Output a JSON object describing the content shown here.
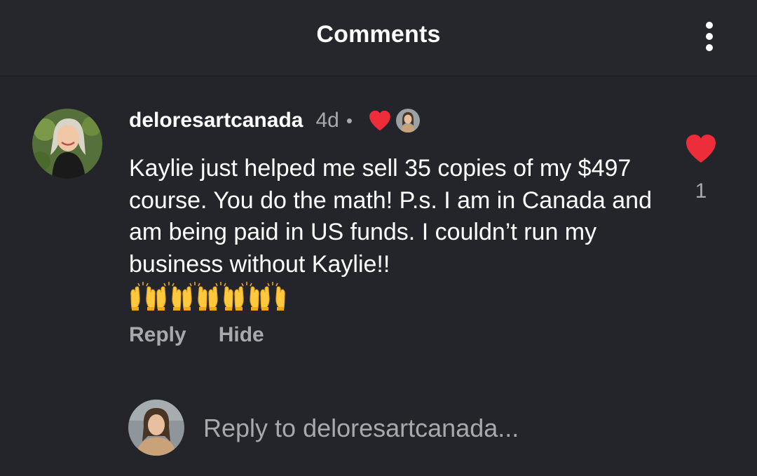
{
  "header": {
    "title": "Comments",
    "menu_icon": "more-vertical-icon"
  },
  "comment": {
    "username": "deloresartcanada",
    "time": "4d",
    "separator": "•",
    "liked_by_author": true,
    "text": "Kaylie just helped me sell 35 copies of my $497 course. You do the math!  P.s. I am in Canada and am being paid in US funds. I couldn’t run my business without Kaylie!!",
    "emoji": "raising-hands-icon",
    "emoji_count": 6,
    "like_count": "1",
    "actions": {
      "reply": "Reply",
      "hide": "Hide"
    }
  },
  "reply_box": {
    "placeholder": "Reply to deloresartcanada..."
  },
  "colors": {
    "background": "#24252a",
    "header": "#26272c",
    "heart": "#ee2d3a",
    "secondary_text": "#a8a9ad",
    "primary_text": "#ffffff"
  }
}
